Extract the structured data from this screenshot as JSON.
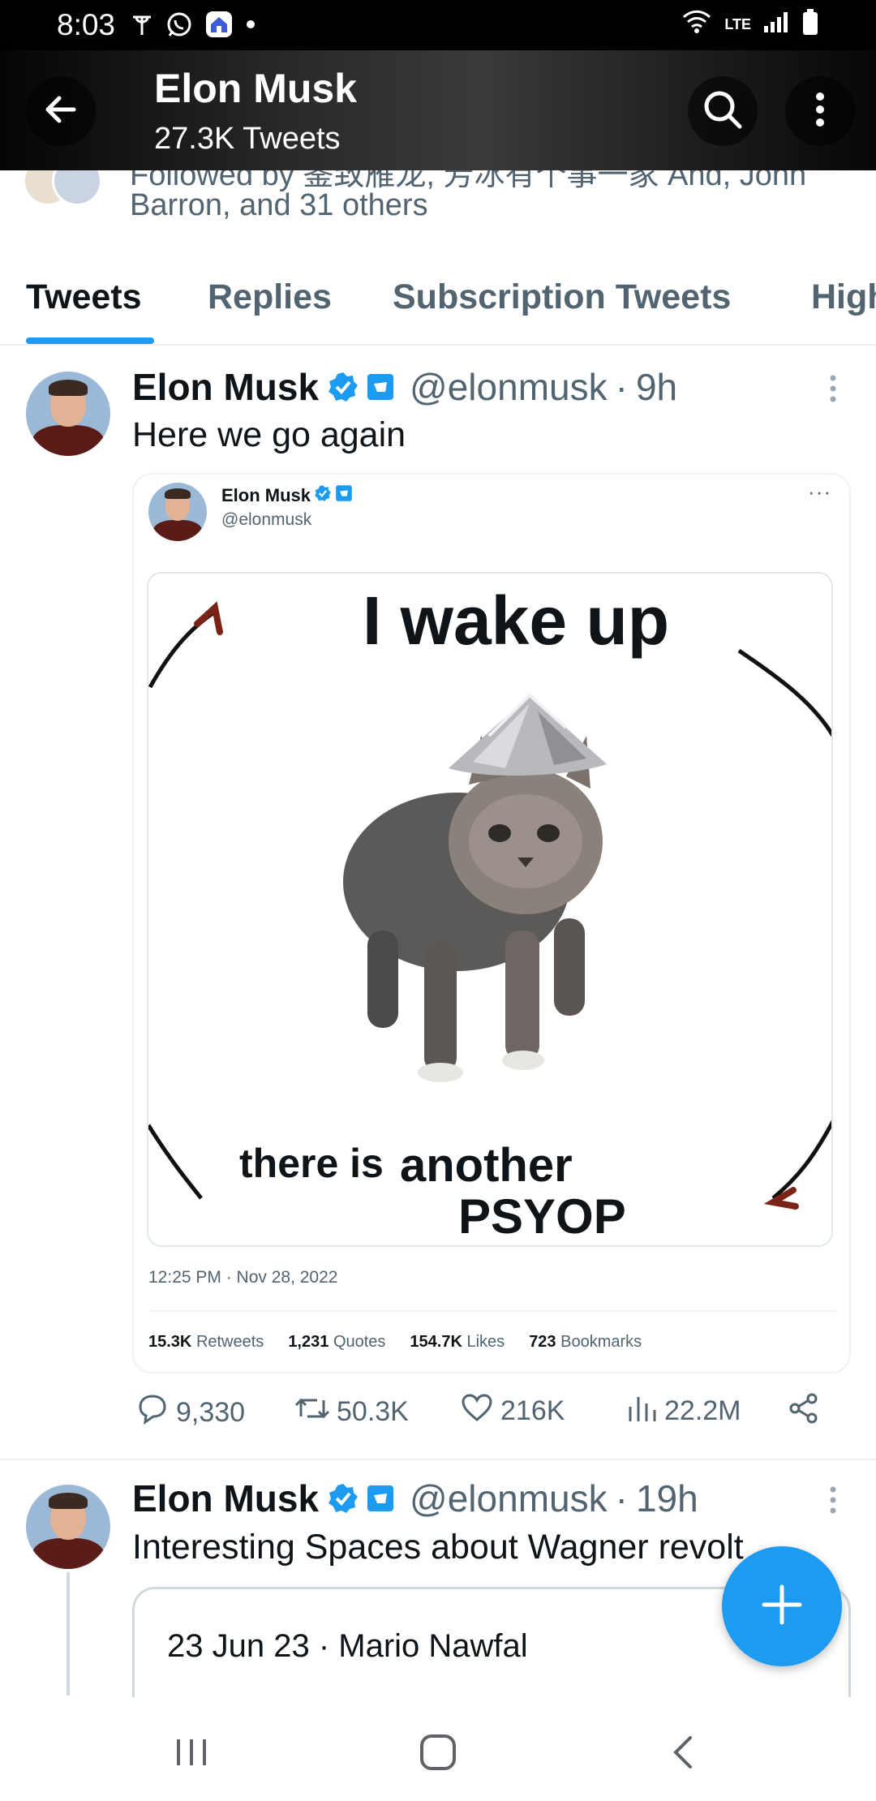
{
  "status_bar": {
    "time": "8:03",
    "network": "LTE",
    "icons_left": [
      "antenna-icon",
      "whatsapp-icon",
      "home-app-icon",
      "dot-icon"
    ],
    "icons_right": [
      "wifi-icon",
      "signal-icon",
      "battery-icon"
    ]
  },
  "header": {
    "title": "Elon Musk",
    "subtitle": "27.3K Tweets",
    "icons": [
      "back-arrow-icon",
      "search-icon",
      "more-vertical-icon"
    ]
  },
  "followed_by": {
    "cut_line": "Followed by 鉴致雁龙, 芳冰有个事一家 And, John",
    "visible_line": "Barron, and 31 others"
  },
  "tabs": [
    {
      "label": "Tweets",
      "active": true
    },
    {
      "label": "Replies",
      "active": false
    },
    {
      "label": "Subscription Tweets",
      "active": false
    },
    {
      "label": "Highlights",
      "active": false
    }
  ],
  "tweets": [
    {
      "name": "Elon Musk",
      "handle": "@elonmusk",
      "sep": "·",
      "time": "9h",
      "text": "Here we go again",
      "quoted": {
        "name": "Elon Musk",
        "handle": "@elonmusk",
        "more": "···",
        "meme_top": "I wake up",
        "meme_bottom_1": "there is",
        "meme_bottom_2": "another",
        "meme_bottom_3": "PSYOP",
        "datetime": "12:25 PM · Nov 28, 2022",
        "stats": [
          {
            "value": "15.3K",
            "label": "Retweets"
          },
          {
            "value": "1,231",
            "label": "Quotes"
          },
          {
            "value": "154.7K",
            "label": "Likes"
          },
          {
            "value": "723",
            "label": "Bookmarks"
          }
        ]
      },
      "actions": {
        "replies": "9,330",
        "retweets": "50.3K",
        "likes": "216K",
        "views": "22.2M"
      }
    },
    {
      "name": "Elon Musk",
      "handle": "@elonmusk",
      "sep": "·",
      "time": "19h",
      "text": "Interesting Spaces about Wagner revolt",
      "card": {
        "date": "23 Jun 23",
        "sep": "·",
        "host": "Mario Nawfal"
      }
    }
  ],
  "colors": {
    "accent": "#1d9bf0",
    "text": "#0f1419",
    "muted": "#536471",
    "verified_square": "#1d9bf0"
  }
}
